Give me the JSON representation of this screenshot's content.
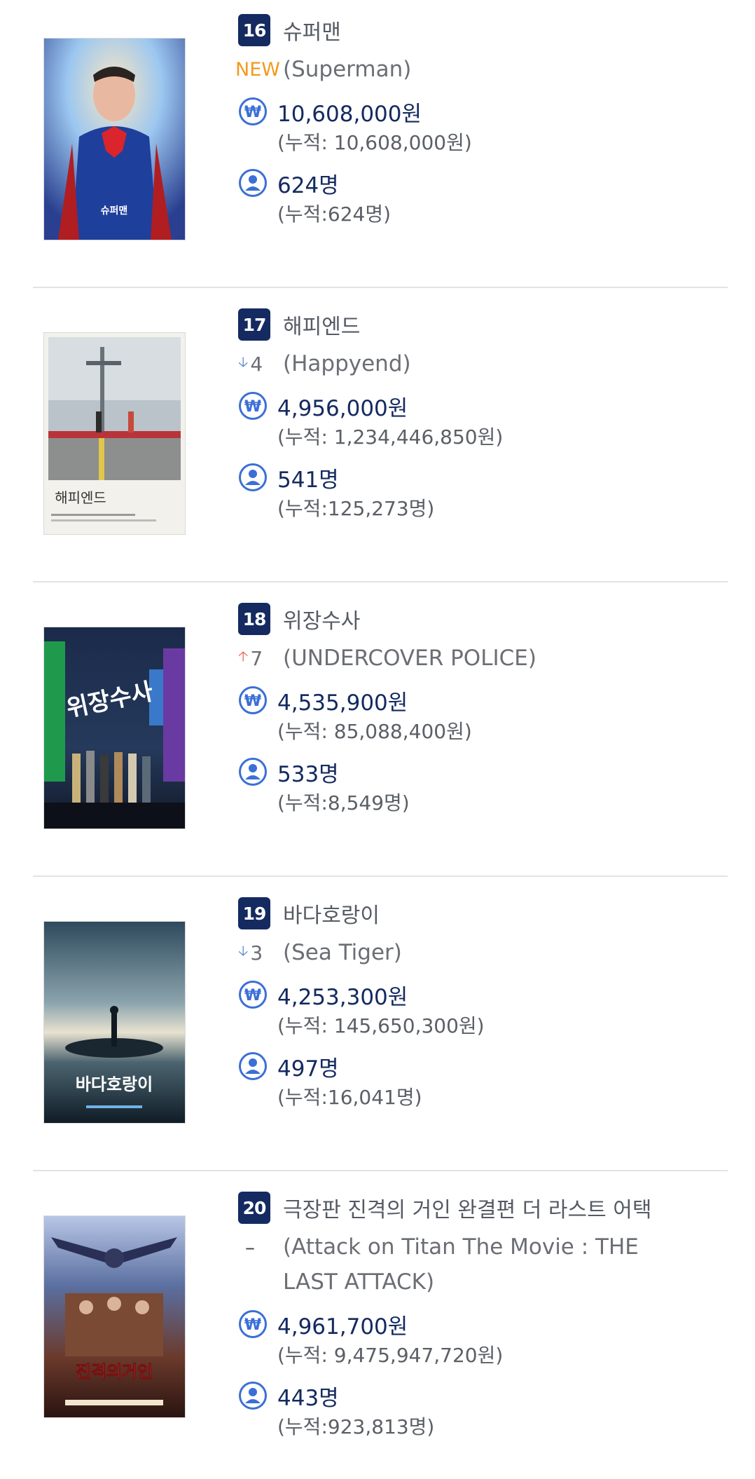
{
  "items": [
    {
      "rank": "16",
      "title_kr": "슈퍼맨",
      "change_type": "new",
      "change_label": "NEW",
      "title_en": "(Superman)",
      "revenue": "10,608,000원",
      "revenue_total": "(누적: 10,608,000원)",
      "audience": "624명",
      "audience_total": "(누적:624명)",
      "poster_text": "슈퍼맨"
    },
    {
      "rank": "17",
      "title_kr": "해피엔드",
      "change_type": "down",
      "change_label": "4",
      "title_en": "(Happyend)",
      "revenue": "4,956,000원",
      "revenue_total": "(누적: 1,234,446,850원)",
      "audience": "541명",
      "audience_total": "(누적:125,273명)",
      "poster_text": "해피엔드"
    },
    {
      "rank": "18",
      "title_kr": "위장수사",
      "change_type": "up",
      "change_label": "7",
      "title_en": "(UNDERCOVER POLICE)",
      "revenue": "4,535,900원",
      "revenue_total": "(누적: 85,088,400원)",
      "audience": "533명",
      "audience_total": "(누적:8,549명)",
      "poster_text": "위장수사"
    },
    {
      "rank": "19",
      "title_kr": "바다호랑이",
      "change_type": "down",
      "change_label": "3",
      "title_en": "(Sea Tiger)",
      "revenue": "4,253,300원",
      "revenue_total": "(누적: 145,650,300원)",
      "audience": "497명",
      "audience_total": "(누적:16,041명)",
      "poster_text": "바다호랑이"
    },
    {
      "rank": "20",
      "title_kr": "극장판 진격의 거인 완결편 더 라스트 어택",
      "change_type": "same",
      "change_label": "–",
      "title_en": "(Attack on Titan The Movie : THE LAST ATTACK)",
      "revenue": "4,961,700원",
      "revenue_total": "(누적: 9,475,947,720원)",
      "audience": "443명",
      "audience_total": "(누적:923,813명)",
      "poster_text": "진격의거인"
    }
  ],
  "icons": {
    "revenue": "won-coin-icon",
    "audience": "person-icon",
    "down": "arrow-down-icon",
    "up": "arrow-up-icon"
  },
  "colors": {
    "rank_badge": "#142a60",
    "value_text": "#142a60",
    "icon_blue": "#3b6fd6",
    "new": "#f39a1e",
    "arrow_down": "#4a7fd8",
    "arrow_up": "#ef5a4a"
  }
}
